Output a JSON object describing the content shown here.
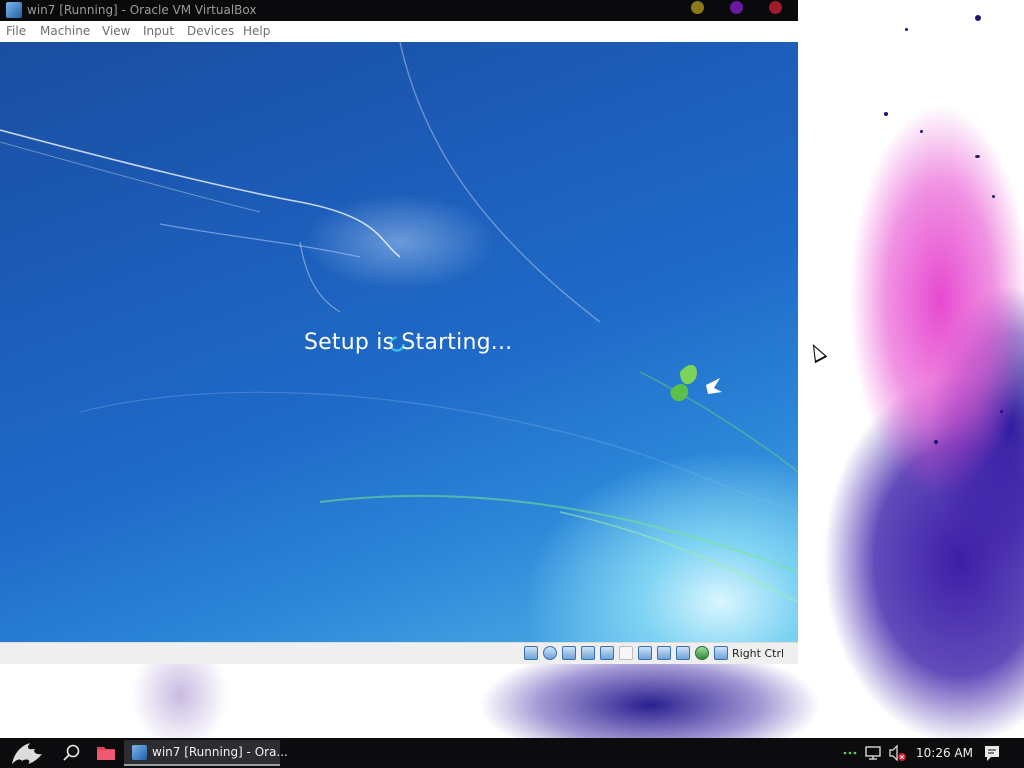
{
  "window": {
    "title": "win7 [Running] - Oracle VM VirtualBox",
    "controls": [
      {
        "name": "minimize",
        "color": "#8a7a1a"
      },
      {
        "name": "maximize",
        "color": "#6a1aa0"
      },
      {
        "name": "close",
        "color": "#a01a2a"
      }
    ]
  },
  "menubar": {
    "items": [
      "File",
      "Machine",
      "View",
      "Input",
      "Devices",
      "Help"
    ]
  },
  "guest": {
    "status_text": "Setup is Starting..."
  },
  "statusbar": {
    "icons": [
      "hard-disk-icon",
      "optical-drive-icon",
      "audio-icon",
      "network-icon",
      "usb-icon",
      "shared-folders-icon",
      "display-icon",
      "video-capture-icon",
      "cpu-icon",
      "mouse-integration-icon",
      "keyboard-icon"
    ],
    "host_key": "Right Ctrl"
  },
  "taskbar": {
    "task_label": "win7 [Running] - Ora...",
    "clock": "10:26 AM",
    "tray_icons": [
      "overflow-dots-icon",
      "network-disconnected-icon",
      "volume-muted-icon",
      "notifications-icon"
    ],
    "colors": {
      "background": "#0c0c0e",
      "task_active": "#2d2d31"
    }
  }
}
